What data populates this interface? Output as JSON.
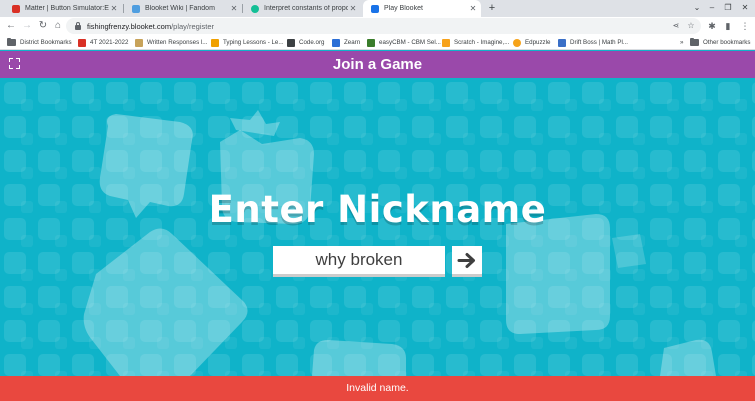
{
  "browser": {
    "tabs": [
      {
        "title": "Matter | Button Simulator:ED Wi",
        "icon": "youtube-icon",
        "color": "#d93025",
        "active": false
      },
      {
        "title": "Blooket Wiki | Fandom",
        "icon": "blooket-wiki-icon",
        "color": "#4f9ee0",
        "active": false
      },
      {
        "title": "Interpret constants of proportion",
        "icon": "khan-academy-icon",
        "color": "#14bf96",
        "active": false
      },
      {
        "title": "Play Blooket",
        "icon": "blooket-icon",
        "color": "#1a73e8",
        "active": true
      }
    ],
    "url_host": "fishingfrenzy.blooket.com",
    "url_path": "/play/register",
    "bookmarks": [
      {
        "label": "District Bookmarks",
        "icon": "folder-icon"
      },
      {
        "label": "4T 2021-2022",
        "icon": "bookmark-icon",
        "color": "#d93025"
      },
      {
        "label": "Written Responses l...",
        "icon": "bookmark-icon",
        "color": "#c8a35a"
      },
      {
        "label": "Typing Lessons - Le...",
        "icon": "bookmark-icon",
        "color": "#f0a000"
      },
      {
        "label": "Code.org",
        "icon": "bookmark-icon",
        "color": "#3c4043"
      },
      {
        "label": "Zearn",
        "icon": "bookmark-icon",
        "color": "#2c6fd6"
      },
      {
        "label": "easyCBM - CBM Sel...",
        "icon": "bookmark-icon",
        "color": "#3a7d2b"
      },
      {
        "label": "Scratch - Imagine,...",
        "icon": "bookmark-icon",
        "color": "#f7a21b"
      },
      {
        "label": "Edpuzzle",
        "icon": "bookmark-icon",
        "color": "#f6a31a"
      },
      {
        "label": "Drift Boss | Math Pl...",
        "icon": "bookmark-icon",
        "color": "#3a6fc7"
      }
    ],
    "other_bookmarks": "Other bookmarks"
  },
  "page": {
    "title": "Join a Game",
    "heading": "Enter Nickname",
    "nickname_value": "why broken",
    "submit_icon": "arrow-right-icon",
    "error": "Invalid name.",
    "colors": {
      "topbar": "#9a49aa",
      "background": "#0fb3c9",
      "error": "#e9483f"
    }
  }
}
